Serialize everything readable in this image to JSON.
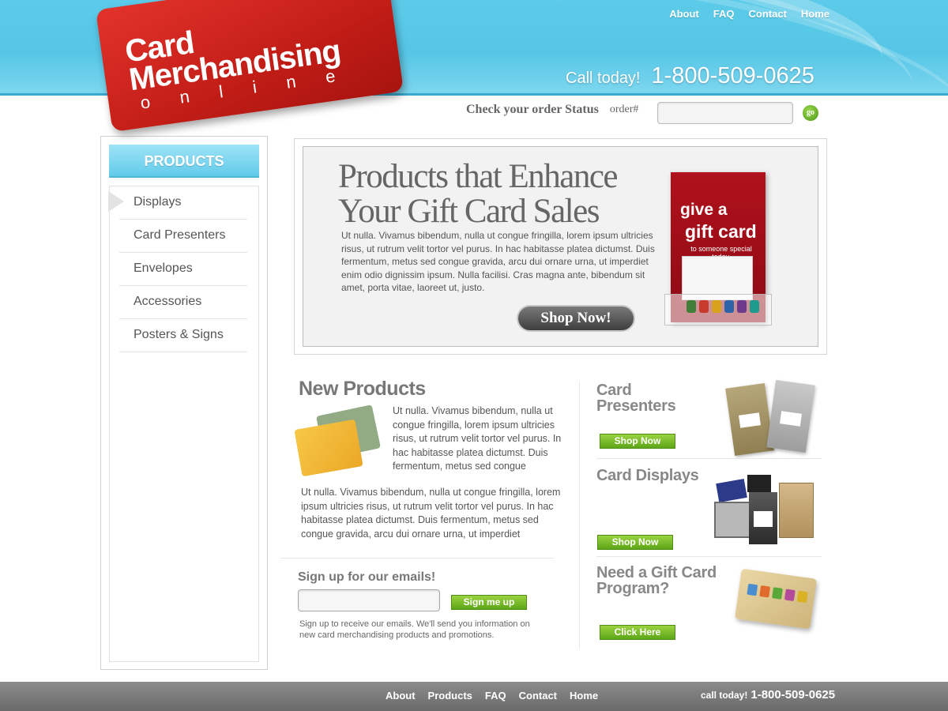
{
  "header": {
    "nav": [
      "About",
      "FAQ",
      "Contact",
      "Home"
    ],
    "call_label": "Call today!",
    "phone": "1-800-509-0625"
  },
  "logo": {
    "line1": "Card",
    "line2": "Merchandising",
    "line3": "online"
  },
  "order_status": {
    "label": "Check your order Status",
    "field_label": "order#",
    "input_value": "",
    "button_label": "go"
  },
  "sidebar": {
    "heading": "PRODUCTS",
    "items": [
      "Displays",
      "Card Presenters",
      "Envelopes",
      "Accessories",
      "Posters & Signs"
    ],
    "active_index": 0
  },
  "banner": {
    "title": "Products that Enhance Your Gift Card Sales",
    "body": "Ut nulla. Vivamus bibendum, nulla ut congue fringilla, lorem ipsum ultricies risus, ut rutrum velit tortor vel purus. In hac habitasse platea dictumst. Duis fermentum, metus sed congue gravida, arcu dui ornare urna, ut imperdiet enim odio dignissim ipsum. Nulla facilisi. Cras magna ante, bibendum sit amet, porta vitae, laoreet ut, justo.",
    "button": "Shop Now!",
    "display_line1": "give a",
    "display_line2": "gift card",
    "display_line3": "to someone special today."
  },
  "new_products": {
    "title": "New Products",
    "text1": "Ut nulla. Vivamus bibendum, nulla ut congue fringilla, lorem ipsum ultricies risus, ut rutrum velit tortor vel purus. In hac habitasse platea dictumst. Duis fermentum, metus sed congue",
    "text2": "Ut nulla. Vivamus bibendum, nulla ut congue fringilla, lorem ipsum ultricies risus, ut rutrum velit tortor vel purus. In hac habitasse platea dictumst. Duis fermentum, metus sed congue gravida, arcu dui ornare urna, ut imperdiet"
  },
  "signup": {
    "title": "Sign up for our emails!",
    "input_value": "",
    "button": "Sign me up",
    "text": "Sign up to receive our emails. We'll send you information on new card merchandising products and  promotions."
  },
  "promos": {
    "presenters": {
      "title": "Card Presenters",
      "button": "Shop Now"
    },
    "displays": {
      "title": "Card Displays",
      "button": "Shop Now"
    },
    "program": {
      "title": "Need a Gift Card Program?",
      "button": "Click Here"
    }
  },
  "footer": {
    "nav": [
      "About",
      "Products",
      "FAQ",
      "Contact",
      "Home"
    ],
    "call_label": "call today!",
    "phone": "1-800-509-0625"
  },
  "colors": {
    "header_blue": "#5ccbe9",
    "logo_red": "#c21d17",
    "button_green": "#6fb524",
    "footer_gray": "#7a7a7a"
  }
}
